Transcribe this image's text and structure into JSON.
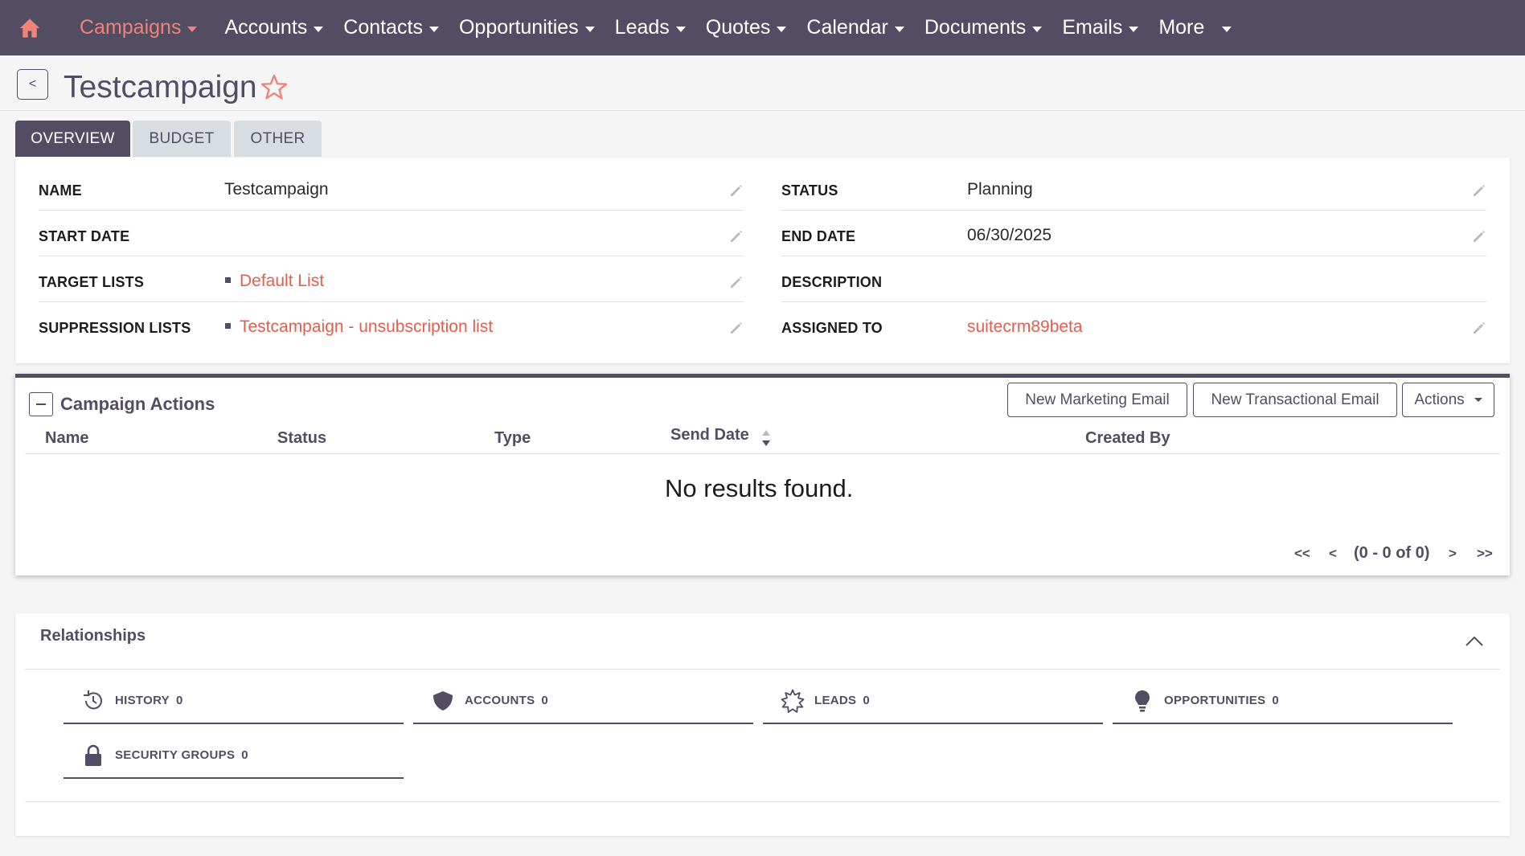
{
  "nav": {
    "items": [
      {
        "label": "Campaigns"
      },
      {
        "label": "Accounts"
      },
      {
        "label": "Contacts"
      },
      {
        "label": "Opportunities"
      },
      {
        "label": "Leads"
      },
      {
        "label": "Quotes"
      },
      {
        "label": "Calendar"
      },
      {
        "label": "Documents"
      },
      {
        "label": "Emails"
      },
      {
        "label": "More"
      }
    ],
    "active": "Campaigns"
  },
  "header": {
    "back_label": "<",
    "title": "Testcampaign"
  },
  "tabs": [
    {
      "label": "OVERVIEW"
    },
    {
      "label": "BUDGET"
    },
    {
      "label": "OTHER"
    }
  ],
  "fields": {
    "name": {
      "label": "NAME",
      "value": "Testcampaign"
    },
    "status": {
      "label": "STATUS",
      "value": "Planning"
    },
    "start_date": {
      "label": "START DATE",
      "value": ""
    },
    "end_date": {
      "label": "END DATE",
      "value": "06/30/2025"
    },
    "target_lists": {
      "label": "TARGET LISTS",
      "value": "Default List"
    },
    "description": {
      "label": "DESCRIPTION",
      "value": ""
    },
    "suppression_lists": {
      "label": "SUPPRESSION LISTS",
      "value": "Testcampaign - unsubscription list"
    },
    "assigned_to": {
      "label": "ASSIGNED TO",
      "value": "suitecrm89beta"
    }
  },
  "campaign_actions": {
    "title": "Campaign Actions",
    "buttons": {
      "new_marketing_email": "New Marketing Email",
      "new_transactional_email": "New Transactional Email",
      "actions": "Actions"
    },
    "columns": [
      "Name",
      "Status",
      "Type",
      "Send Date",
      "Created By"
    ],
    "empty_text": "No results found.",
    "pagination": {
      "first": "<<",
      "prev": "<",
      "info": "(0 - 0 of 0)",
      "next": ">",
      "last": ">>"
    }
  },
  "relationships": {
    "title": "Relationships",
    "items": [
      {
        "label": "HISTORY",
        "count": "0",
        "icon": "history-icon"
      },
      {
        "label": "ACCOUNTS",
        "count": "0",
        "icon": "shield-icon"
      },
      {
        "label": "LEADS",
        "count": "0",
        "icon": "star-burst-icon"
      },
      {
        "label": "OPPORTUNITIES",
        "count": "0",
        "icon": "lightbulb-icon"
      },
      {
        "label": "SECURITY GROUPS",
        "count": "0",
        "icon": "lock-icon"
      }
    ]
  },
  "colors": {
    "nav_bg": "#534d64",
    "accent": "#f08377",
    "link": "#e15f4e",
    "page_bg": "#f5f5f5"
  }
}
